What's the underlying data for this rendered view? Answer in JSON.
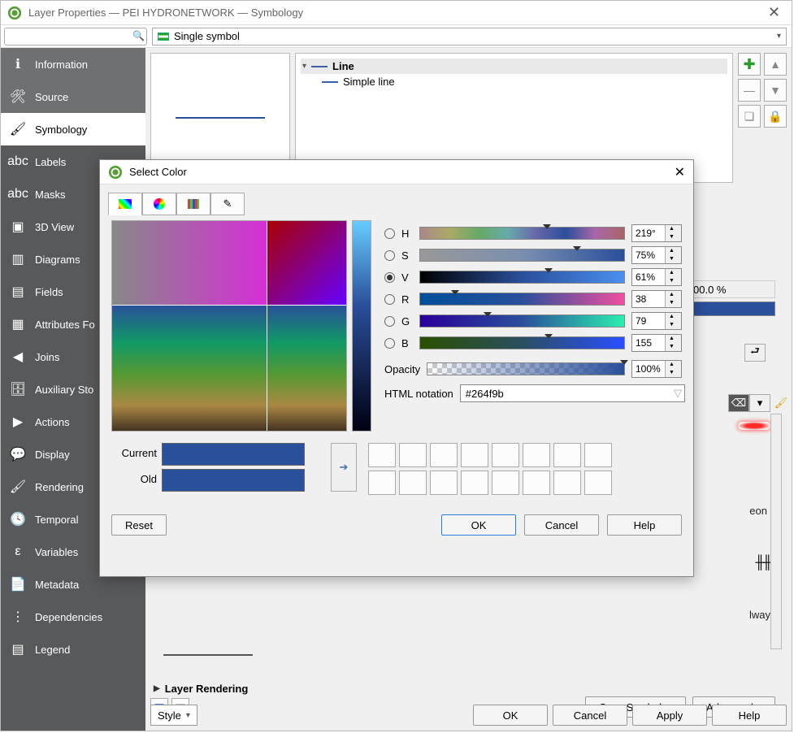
{
  "window": {
    "title": "Layer Properties — PEI HYDRONETWORK — Symbology",
    "symbol_mode": "Single symbol",
    "layer_rendering_label": "Layer Rendering",
    "style_label": "Style",
    "buttons": {
      "ok": "OK",
      "cancel": "Cancel",
      "apply": "Apply",
      "help": "Help",
      "save_symbol": "Save Symbol…",
      "advanced": "Advanced"
    }
  },
  "sidebar": [
    {
      "label": "Information",
      "icon": "ℹ"
    },
    {
      "label": "Source",
      "icon": "🛠"
    },
    {
      "label": "Symbology",
      "icon": "🖌"
    },
    {
      "label": "Labels",
      "icon": "abc"
    },
    {
      "label": "Masks",
      "icon": "abc"
    },
    {
      "label": "3D View",
      "icon": "▣"
    },
    {
      "label": "Diagrams",
      "icon": "▥"
    },
    {
      "label": "Fields",
      "icon": "▤"
    },
    {
      "label": "Attributes Fo",
      "icon": "▦"
    },
    {
      "label": "Joins",
      "icon": "◀"
    },
    {
      "label": "Auxiliary Sto",
      "icon": "🗄"
    },
    {
      "label": "Actions",
      "icon": "▶"
    },
    {
      "label": "Display",
      "icon": "💬"
    },
    {
      "label": "Rendering",
      "icon": "🖌"
    },
    {
      "label": "Temporal",
      "icon": "🕓"
    },
    {
      "label": "Variables",
      "icon": "ε"
    },
    {
      "label": "Metadata",
      "icon": "📄"
    },
    {
      "label": "Dependencies",
      "icon": "⋮"
    },
    {
      "label": "Legend",
      "icon": "▤"
    }
  ],
  "tree": {
    "root": "Line",
    "child": "Simple line"
  },
  "fragments": {
    "opacity_val": "00.0 %",
    "neon": "eon",
    "way": "lway"
  },
  "dialog": {
    "title": "Select Color",
    "channels": [
      {
        "key": "H",
        "value": "219°",
        "grad": "g-h",
        "mark": 60,
        "selected": false
      },
      {
        "key": "S",
        "value": "75%",
        "grad": "g-s",
        "mark": 75,
        "selected": false
      },
      {
        "key": "V",
        "value": "61%",
        "grad": "g-v",
        "mark": 61,
        "selected": true
      },
      {
        "key": "R",
        "value": "38",
        "grad": "g-r",
        "mark": 15,
        "selected": false
      },
      {
        "key": "G",
        "value": "79",
        "grad": "g-g",
        "mark": 31,
        "selected": false
      },
      {
        "key": "B",
        "value": "155",
        "grad": "g-b",
        "mark": 61,
        "selected": false
      }
    ],
    "opacity_label": "Opacity",
    "opacity_value": "100%",
    "html_label": "HTML notation",
    "html_value": "#264f9b",
    "current_label": "Current",
    "old_label": "Old",
    "color": "#264f9b",
    "buttons": {
      "reset": "Reset",
      "ok": "OK",
      "cancel": "Cancel",
      "help": "Help"
    }
  }
}
